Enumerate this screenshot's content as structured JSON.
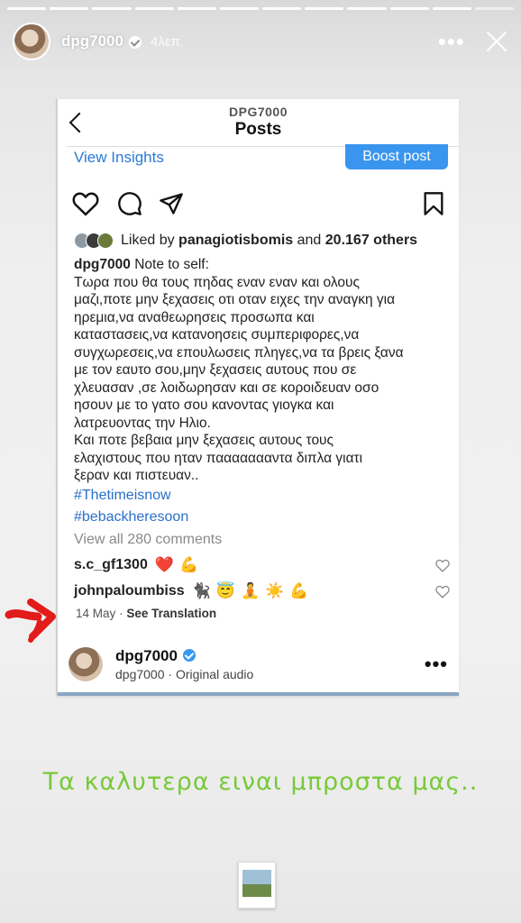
{
  "story": {
    "username": "dpg7000",
    "time": "4λεπ.",
    "progress_total": 12,
    "progress_current": 11,
    "text_overlay": "Τα καλυτερα ειναι μπροστα μας..",
    "text_color": "#79c93a"
  },
  "post": {
    "header_username": "DPG7000",
    "header_title": "Posts",
    "view_insights": "View Insights",
    "boost_post": "Boost post",
    "likes": {
      "prefix": "Liked by",
      "user": "panagiotisbomis",
      "middle": "and",
      "count": "20.167 others"
    },
    "caption": {
      "username": "dpg7000",
      "first": "Note to self:",
      "lines": [
        "Τωρα που θα τους πηδας εναν εναν και ολους",
        "μαζι,ποτε μην ξεχασεις οτι οταν ειχες την αναγκη για",
        "ηρεμια,να αναθεωρησεις προσωπα και",
        "καταστασεις,να κατανοησεις συμπεριφορες,να",
        "συγχωρεσεις,να επουλωσεις πληγες,να τα βρεις ξανα",
        "με τον εαυτο σου,μην ξεχασεις αυτους που σε",
        "χλευασαν ,σε λοιδωρησαν και σε κοροιδευαν οσο",
        "ησουν με το γατο σου κανοντας γιογκα και",
        "λατρευοντας την Ηλιο.",
        "Και ποτε βεβαια μην ξεχασεις αυτους τους",
        "ελαχιστους που ηταν παααααααντα διπλα γιατι",
        "ξεραν και πιστευαν.."
      ],
      "hashtags": [
        "#Thetimeisnow",
        "#bebackheresoon"
      ]
    },
    "view_comments": "View all 280 comments",
    "comments": [
      {
        "user": "s.c_gf1300",
        "emojis": [
          "❤️",
          "💪"
        ]
      },
      {
        "user": "johnpaloumbiss",
        "emojis": [
          "🐈‍⬛",
          "😇",
          "🧘",
          "☀️",
          "💪"
        ]
      }
    ],
    "date": "14 May",
    "separator": "·",
    "see_translation": "See Translation",
    "audio": {
      "username": "dpg7000",
      "subtitle": "dpg7000 · Original audio"
    },
    "link_color": "#2a7ad6",
    "boost_color": "#3a95ef"
  }
}
